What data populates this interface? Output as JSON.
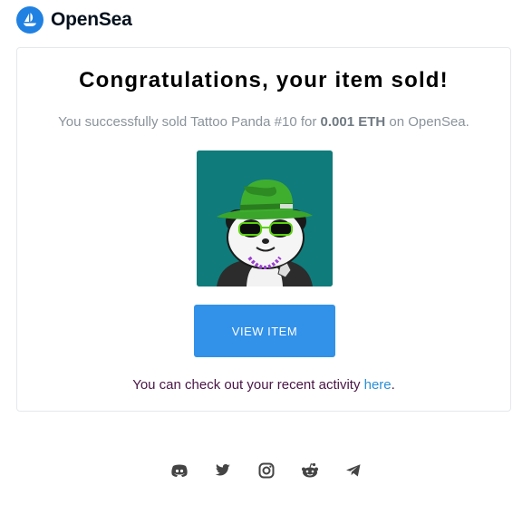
{
  "header": {
    "brand": "OpenSea",
    "logo_icon": "opensea-sailboat-icon"
  },
  "email": {
    "title": "Congratulations, your item sold!",
    "subtitle_prefix": "You successfully sold Tattoo Panda #10 for ",
    "price": "0.001 ETH",
    "subtitle_suffix": " on OpenSea.",
    "item_image_alt": "Tattoo Panda #10",
    "view_button_label": "VIEW ITEM",
    "activity_prefix": "You can check out your recent activity ",
    "activity_link": "here",
    "activity_suffix": "."
  },
  "colors": {
    "accent": "#2081e2",
    "button": "#3291e9",
    "link": "#2a8fd6",
    "nft_bg": "#0f7b7b"
  },
  "footer": {
    "social_icons": [
      "discord-icon",
      "twitter-icon",
      "instagram-icon",
      "reddit-icon",
      "telegram-icon"
    ]
  }
}
